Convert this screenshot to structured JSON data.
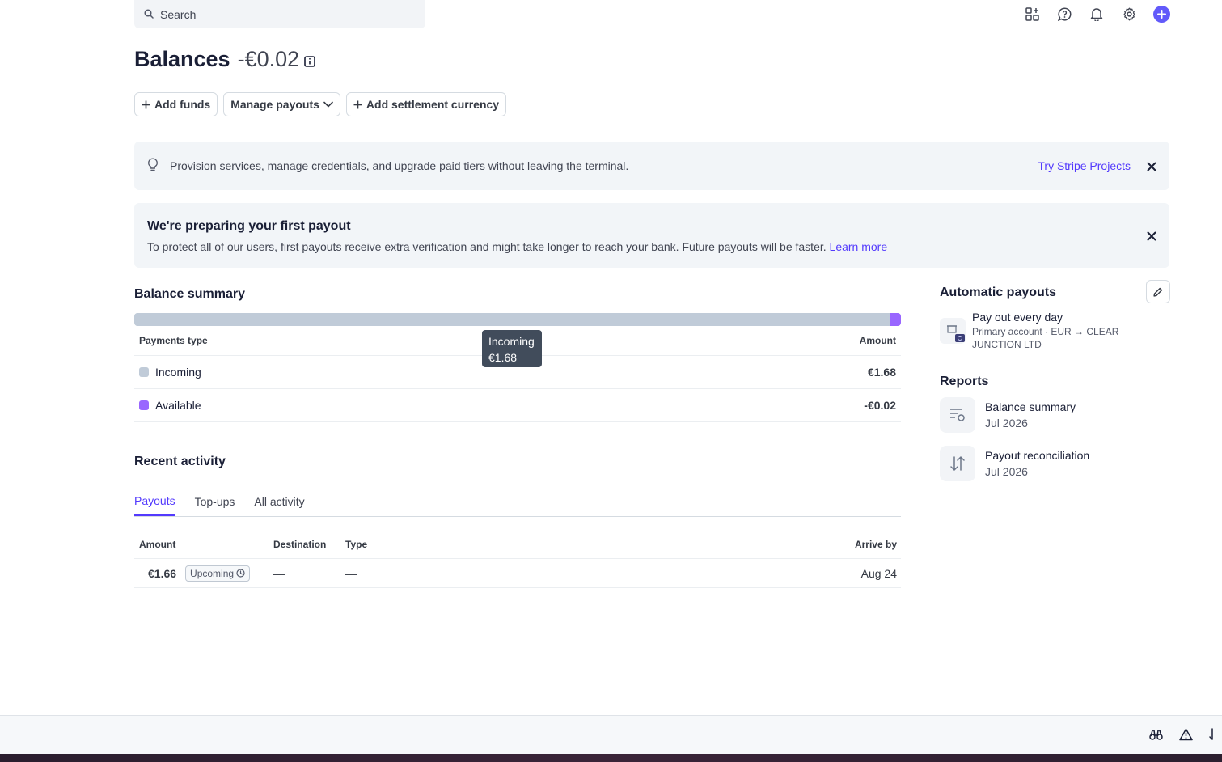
{
  "search": {
    "placeholder": "Search"
  },
  "header": {
    "title": "Balances",
    "balance": "-€0.02"
  },
  "actions": {
    "add_funds": "Add funds",
    "manage_payouts": "Manage payouts",
    "add_settlement_currency": "Add settlement currency"
  },
  "banner_projects": {
    "text": "Provision services, manage credentials, and upgrade paid tiers without leaving the terminal.",
    "link": "Try Stripe Projects"
  },
  "banner_payout": {
    "title": "We're preparing your first payout",
    "text": "To protect all of our users, first payouts receive extra verification and might take longer to reach your bank. Future payouts will be faster.",
    "link": "Learn more"
  },
  "balance_summary": {
    "title": "Balance summary",
    "col_type": "Payments type",
    "col_amount": "Amount",
    "rows": [
      {
        "label": "Incoming",
        "amount": "€1.68",
        "color": "#c0cbd8",
        "bar_fraction": 0.986
      },
      {
        "label": "Available",
        "amount": "-€0.02",
        "color": "#9966ff"
      }
    ],
    "tooltip": {
      "label": "Incoming",
      "value": "€1.68"
    }
  },
  "recent_activity": {
    "title": "Recent activity",
    "tabs": [
      {
        "label": "Payouts",
        "active": true
      },
      {
        "label": "Top-ups",
        "active": false
      },
      {
        "label": "All activity",
        "active": false
      }
    ],
    "columns": {
      "amount": "Amount",
      "destination": "Destination",
      "type": "Type",
      "arrive_by": "Arrive by"
    },
    "rows": [
      {
        "amount": "€1.66",
        "status": "Upcoming",
        "destination": "—",
        "type": "—",
        "arrive_by": "Aug 24"
      }
    ]
  },
  "automatic_payouts": {
    "title": "Automatic payouts",
    "schedule": "Pay out every day",
    "account": "Primary account · EUR → CLEAR JUNCTION LTD"
  },
  "reports": {
    "title": "Reports",
    "items": [
      {
        "name": "Balance summary",
        "period": "Jul 2026"
      },
      {
        "name": "Payout reconciliation",
        "period": "Jul 2026"
      }
    ]
  },
  "colors": {
    "accent": "#533afd",
    "brand_button": "#625afa"
  }
}
